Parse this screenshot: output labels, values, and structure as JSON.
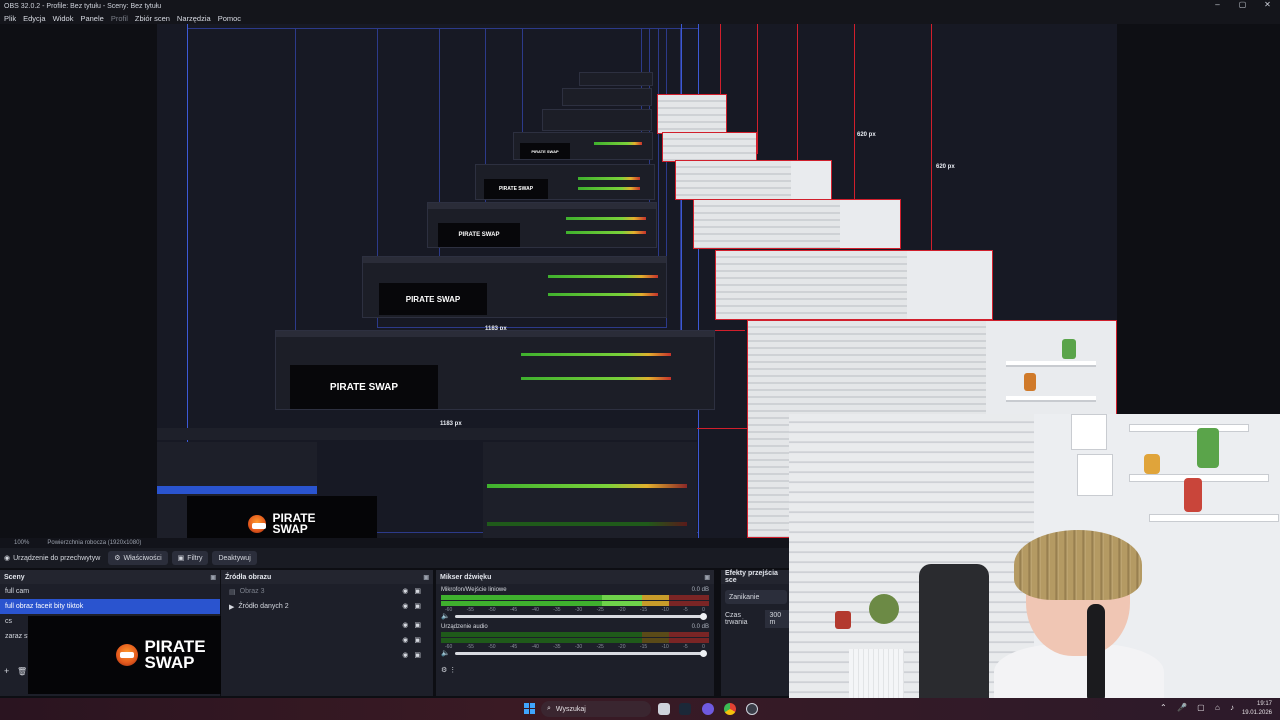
{
  "window": {
    "title": "OBS 32.0.2 - Profile: Bez tytułu - Sceny: Bez tytułu",
    "minimize": "–",
    "maximize": "▢",
    "close": "✕"
  },
  "menu": [
    "Plik",
    "Edycja",
    "Widok",
    "Panele",
    "Profil",
    "Zbiór scen",
    "Narzędzia",
    "Pomoc"
  ],
  "preview": {
    "px_labels": [
      "1183 px",
      "1183 px",
      "620 px",
      "620 px"
    ],
    "zoom": "100%",
    "workspace": "Powierzchnia robocza (1920x1080)"
  },
  "source_bar": {
    "selected_source": "Urządzenie do przechwytyw",
    "properties": "Właściwości",
    "filters": "Filtry",
    "deactivate": "Deaktywuj"
  },
  "scenes": {
    "title": "Sceny",
    "items": [
      "full cam",
      "full obraz faceit  bity tiktok",
      "cs",
      "zaraz st"
    ],
    "selected_index": 1
  },
  "sources": {
    "title": "Źródła obrazu",
    "items": [
      "Obraz 3",
      "Źródło danych 2"
    ]
  },
  "mixer": {
    "title": "Mikser dźwięku",
    "channels": [
      {
        "name": "Mikrofon/Wejście liniowe",
        "db": "0.0 dB"
      },
      {
        "name": "Urządzenie audio",
        "db": "0.0 dB"
      }
    ],
    "ticks": [
      "-60",
      "-55",
      "-50",
      "-45",
      "-40",
      "-35",
      "-30",
      "-25",
      "-20",
      "-15",
      "-10",
      "-5",
      "0"
    ]
  },
  "transitions": {
    "title": "Efekty przejścia sce",
    "effect": "Zanikanie",
    "duration_label": "Czas trwania",
    "duration_value": "300 m"
  },
  "logo": {
    "line1": "PIRATE",
    "line2": "SWAP"
  },
  "taskbar": {
    "search_placeholder": "Wyszukaj",
    "time": "19:17",
    "date": "19.01.2026"
  },
  "icons": {
    "eye": "eye-icon",
    "lock": "lock-icon",
    "gear": "gear-icon",
    "speaker": "speaker-icon",
    "search": "search-icon",
    "windows": "windows-start-icon"
  },
  "colors": {
    "accent": "#2a54cf",
    "outline_red": "#d11f2c",
    "outline_blue": "#3c59d6"
  }
}
